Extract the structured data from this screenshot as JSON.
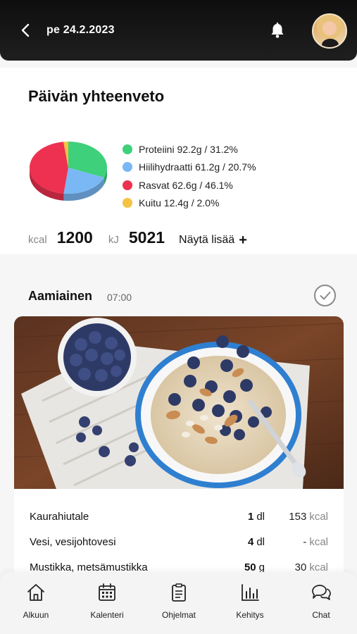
{
  "header": {
    "date": "pe 24.2.2023"
  },
  "summary": {
    "title": "Päivän yhteenveto",
    "legend": [
      {
        "label": "Proteiini 92.2g / 31.2%",
        "color": "#3ed07a"
      },
      {
        "label": "Hiilihydraatti 61.2g / 20.7%",
        "color": "#7ab8f5"
      },
      {
        "label": "Rasvat 62.6g / 46.1%",
        "color": "#ee3150"
      },
      {
        "label": "Kuitu 12.4g / 2.0%",
        "color": "#f5c242"
      }
    ],
    "pie_values": [
      31.2,
      20.7,
      46.1,
      2.0
    ],
    "kcal_label": "kcal",
    "kcal_value": "1200",
    "kj_label": "kJ",
    "kj_value": "5021",
    "more_label": "Näytä lisää",
    "more_icon": "+"
  },
  "meal": {
    "title": "Aamiainen",
    "time": "07:00",
    "items": [
      {
        "name": "Kaurahiutale",
        "amount": "1",
        "unit": "dl",
        "kcal": "153",
        "kcal_unit": "kcal"
      },
      {
        "name": "Vesi, vesijohtovesi",
        "amount": "4",
        "unit": "dl",
        "kcal": "-",
        "kcal_unit": "kcal"
      },
      {
        "name": "Mustikka, metsämustikka",
        "amount": "50",
        "unit": "g",
        "kcal": "30",
        "kcal_unit": "kcal"
      }
    ]
  },
  "nav": {
    "items": [
      {
        "label": "Alkuun",
        "icon": "home-icon"
      },
      {
        "label": "Kalenteri",
        "icon": "calendar-icon"
      },
      {
        "label": "Ohjelmat",
        "icon": "clipboard-icon"
      },
      {
        "label": "Kehitys",
        "icon": "bar-chart-icon"
      },
      {
        "label": "Chat",
        "icon": "chat-icon"
      }
    ]
  }
}
